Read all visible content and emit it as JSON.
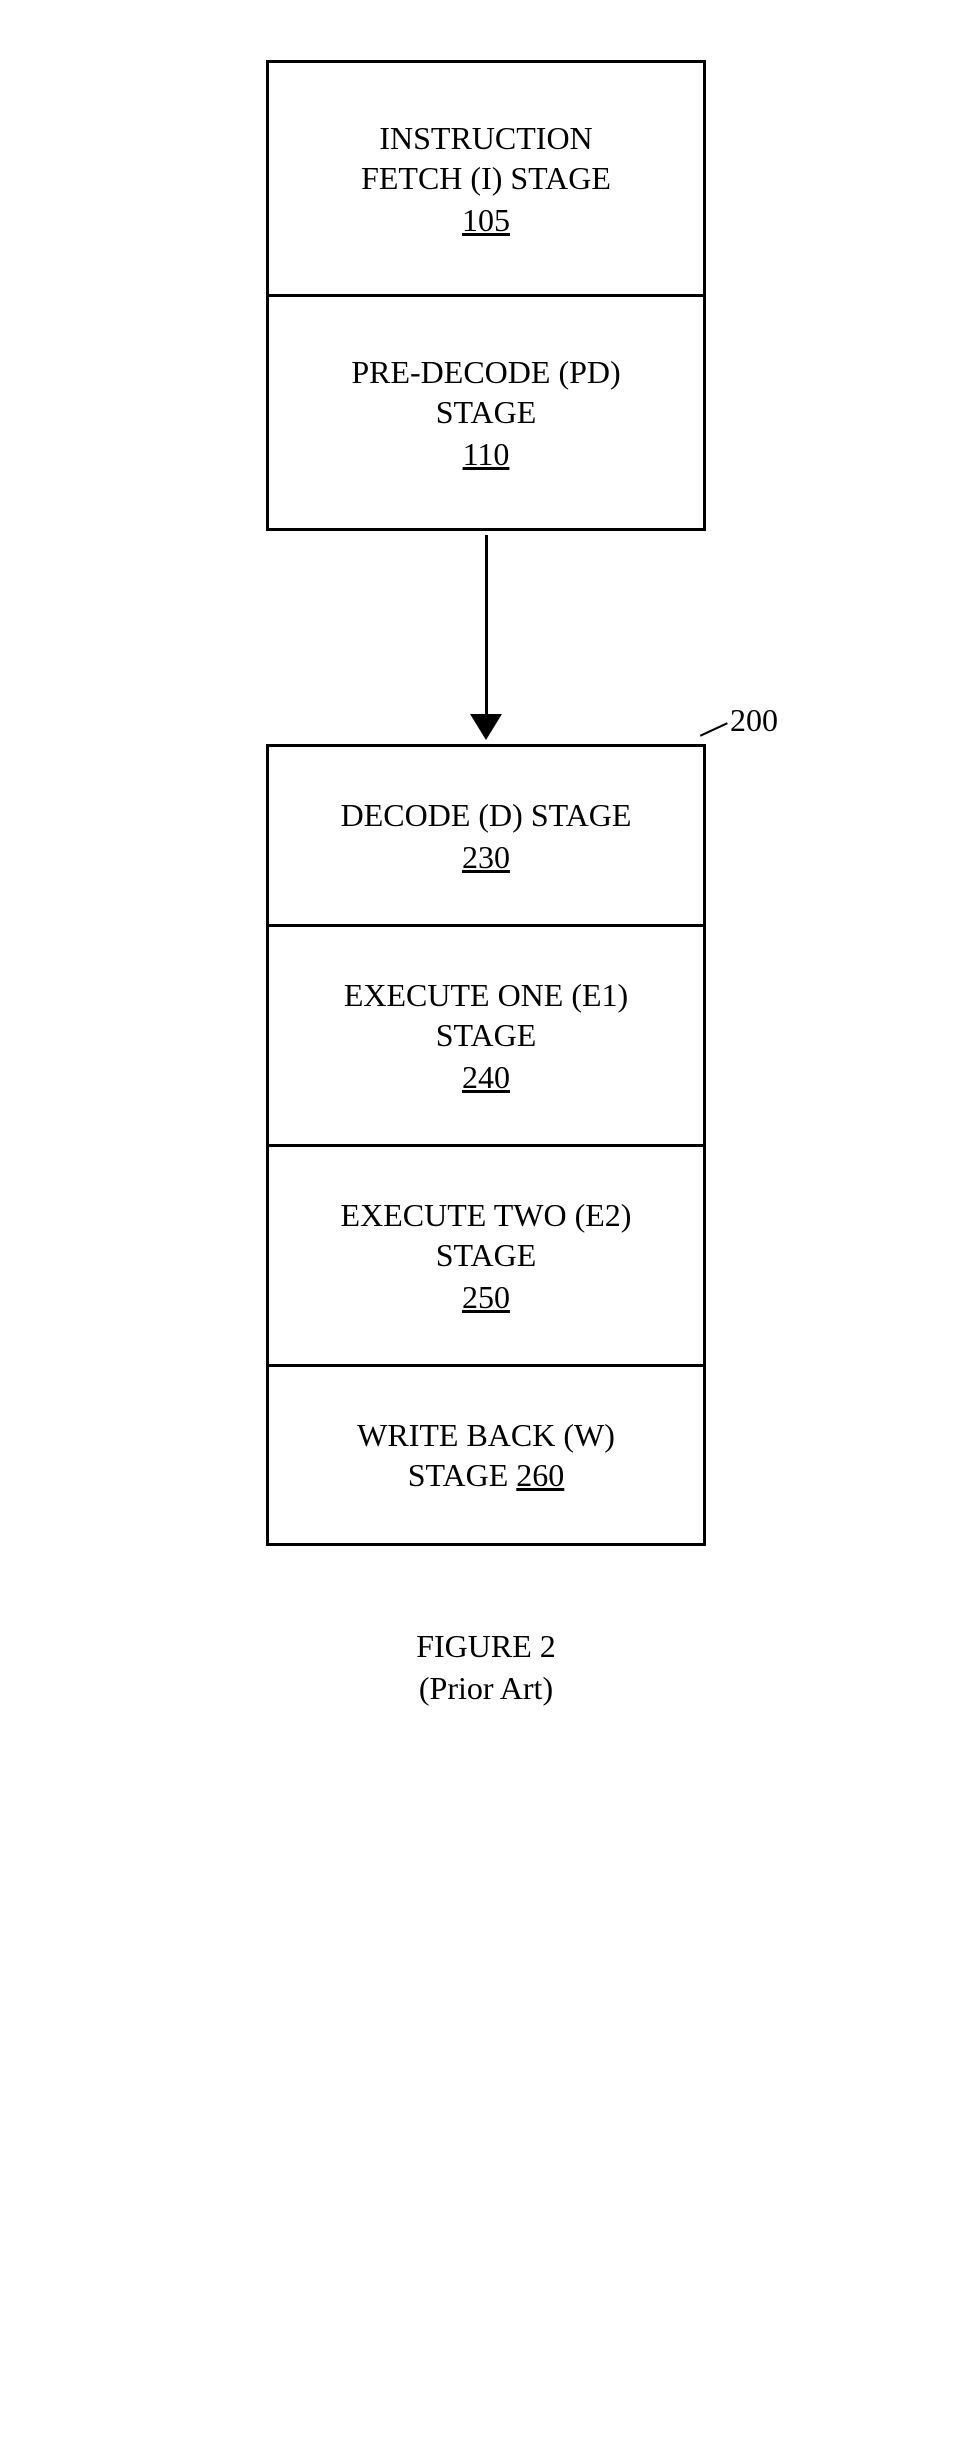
{
  "top_group": {
    "stages": [
      {
        "title_line1": "INSTRUCTION",
        "title_line2": "FETCH (I) STAGE",
        "ref": "105"
      },
      {
        "title_line1": "PRE-DECODE (PD)",
        "title_line2": "STAGE",
        "ref": "110"
      }
    ]
  },
  "bottom_group": {
    "ref_label": "200",
    "stages": [
      {
        "title_line1": "DECODE (D) STAGE",
        "title_line2": "",
        "ref": "230"
      },
      {
        "title_line1": "EXECUTE ONE (E1)",
        "title_line2": "STAGE",
        "ref": "240"
      },
      {
        "title_line1": "EXECUTE TWO (E2)",
        "title_line2": "STAGE",
        "ref": "250"
      },
      {
        "title_line1_pre": "WRITE BACK (W)",
        "title_line2_pre": "STAGE ",
        "ref_inline": "260"
      }
    ]
  },
  "caption": {
    "line1": "FIGURE 2",
    "line2": "(Prior Art)"
  }
}
